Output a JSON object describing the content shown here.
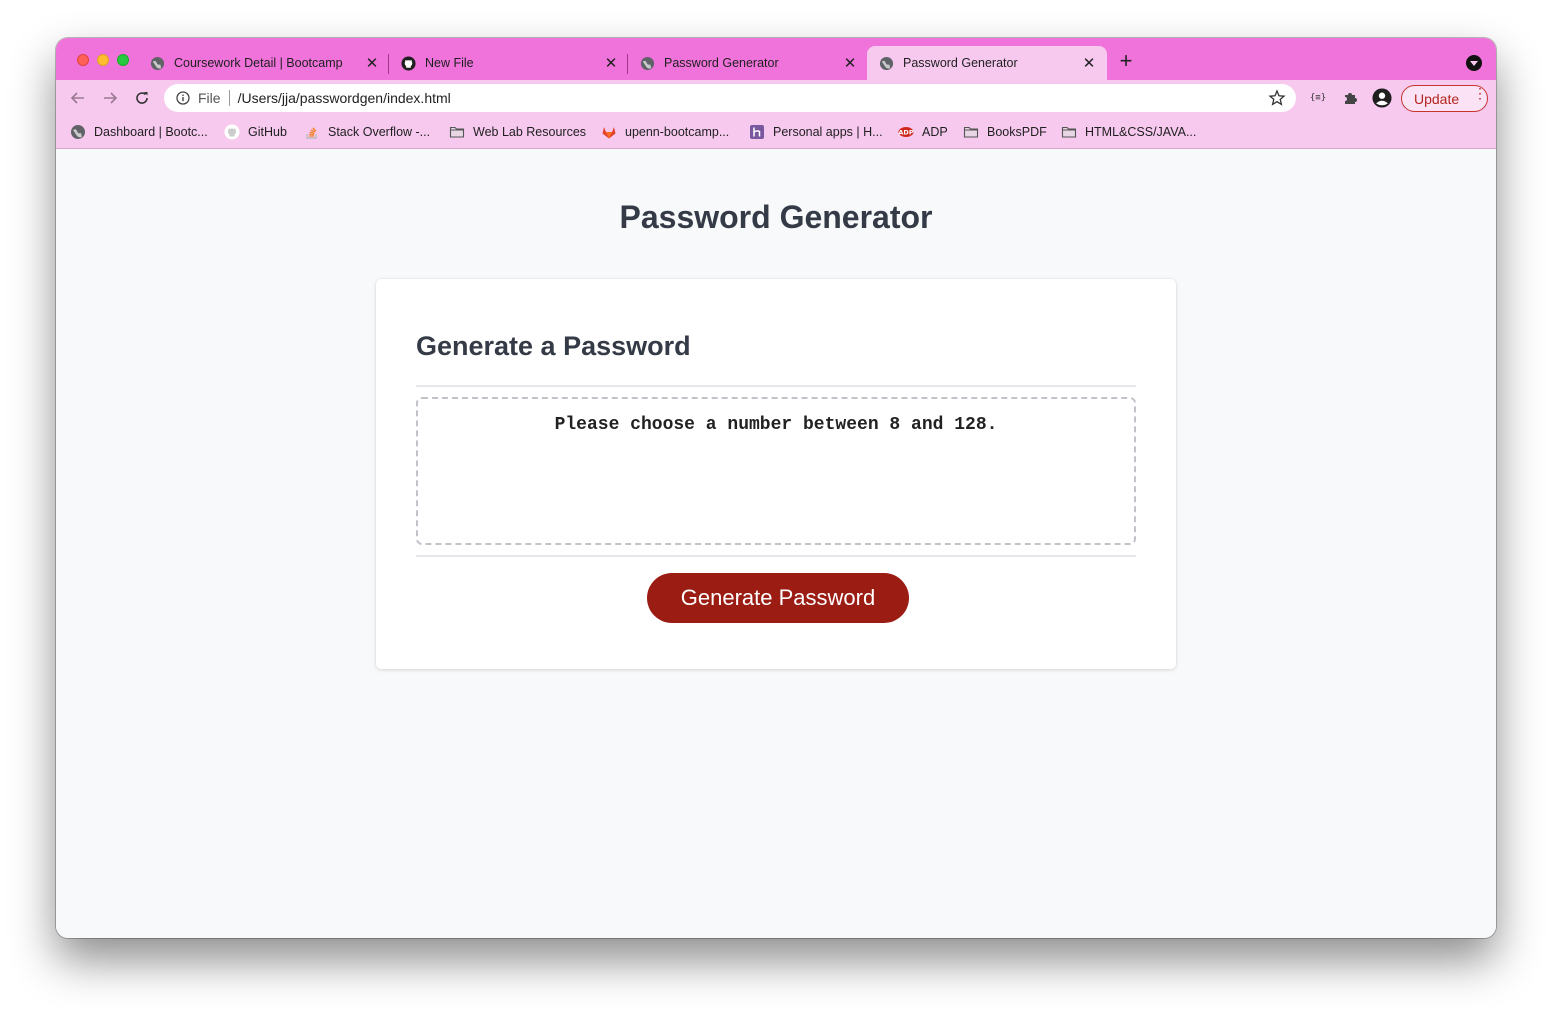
{
  "browser": {
    "tabs": [
      {
        "title": "Coursework Detail | Bootcamp",
        "icon": "globe-icon"
      },
      {
        "title": "New File",
        "icon": "github-icon"
      },
      {
        "title": "Password Generator",
        "icon": "globe-icon"
      },
      {
        "title": "Password Generator",
        "icon": "globe-icon",
        "active": true
      }
    ],
    "omnibox": {
      "scheme_label": "File",
      "url": "/Users/jja/passwordgen/index.html"
    },
    "update_label": "Update",
    "bookmarks": [
      {
        "label": "Dashboard | Bootc...",
        "icon": "globe-icon"
      },
      {
        "label": "GitHub",
        "icon": "github-icon"
      },
      {
        "label": "Stack Overflow -...",
        "icon": "stackoverflow-icon"
      },
      {
        "label": "Web Lab Resources",
        "icon": "folder-icon"
      },
      {
        "label": "upenn-bootcamp...",
        "icon": "gitlab-icon"
      },
      {
        "label": "Personal apps | H...",
        "icon": "heroku-icon"
      },
      {
        "label": "ADP",
        "icon": "adp-icon"
      },
      {
        "label": "BooksPDF",
        "icon": "folder-icon"
      },
      {
        "label": "HTML&CSS/JAVA...",
        "icon": "folder-icon"
      }
    ]
  },
  "page": {
    "title": "Password Generator",
    "card": {
      "heading": "Generate a Password",
      "password_text": "Please choose a number between 8 and 128.",
      "button_label": "Generate Password"
    }
  },
  "colors": {
    "tabstrip": "#ef73da",
    "toolbar": "#f7c9ef",
    "button": "#9b1c13",
    "heading": "#343a46"
  }
}
